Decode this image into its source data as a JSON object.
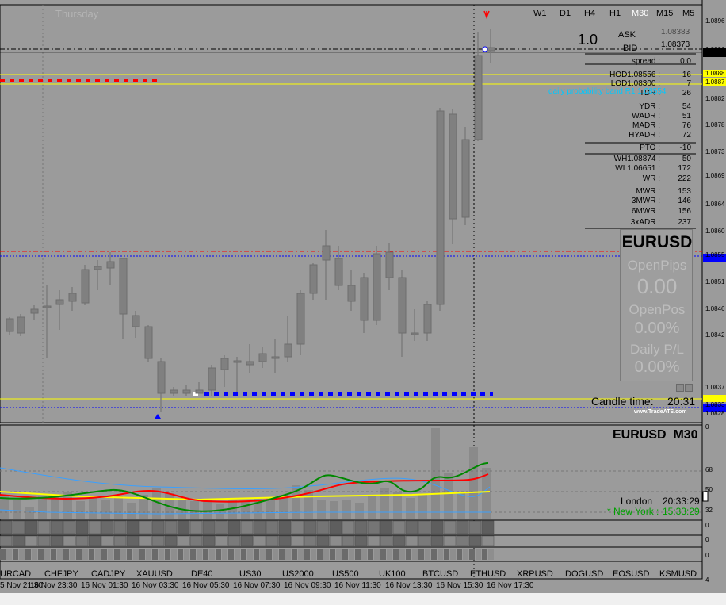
{
  "colors": {
    "bg": "#9b9b9b",
    "bull": "#8c8c8c",
    "bear": "#808080",
    "yellow": "#ffff00",
    "red": "#ff0000",
    "blue": "#0000ff",
    "green": "#008800",
    "cyan": "#00c8ff"
  },
  "header": {
    "day_label": "Thursday",
    "ratio": "1.0",
    "ask_label": "ASK",
    "ask_value": "1.08383",
    "bid_label": "BID",
    "bid_value": "1.08373"
  },
  "timeframes": [
    {
      "label": "W1",
      "active": false
    },
    {
      "label": "D1",
      "active": false
    },
    {
      "label": "H4",
      "active": false
    },
    {
      "label": "H1",
      "active": false
    },
    {
      "label": "M30",
      "active": true
    },
    {
      "label": "M15",
      "active": false
    },
    {
      "label": "M5",
      "active": false
    }
  ],
  "stats": [
    {
      "label": "spread :",
      "value": "0.0"
    },
    {
      "label": "HOD1.08556 :",
      "value": "16"
    },
    {
      "label": "LOD1.08300 :",
      "value": "7"
    },
    {
      "label": "TDR :",
      "value": "26"
    },
    {
      "label": "YDR :",
      "value": "54"
    },
    {
      "label": "WADR :",
      "value": "51"
    },
    {
      "label": "MADR :",
      "value": "76"
    },
    {
      "label": "HYADR :",
      "value": "72"
    },
    {
      "label": "PTO :",
      "value": "-10"
    },
    {
      "label": "WH1.08874 :",
      "value": "50"
    },
    {
      "label": "WL1.06651 :",
      "value": "172"
    },
    {
      "label": "WR :",
      "value": "222"
    },
    {
      "label": "MWR :",
      "value": "153"
    },
    {
      "label": "3MWR :",
      "value": "146"
    },
    {
      "label": "6MWR :",
      "value": "156"
    },
    {
      "label": "3xADR :",
      "value": "237"
    }
  ],
  "probability_band": "daily probability band R1 1.08554",
  "info_panel": {
    "symbol": "EURUSD",
    "open_pips_label": "OpenPips",
    "open_pips_value": "0.00",
    "open_pos_label": "OpenPos",
    "open_pos_value": "0.00%",
    "daily_pl_label": "Daily P/L",
    "daily_pl_value": "0.00%"
  },
  "candle_time": {
    "label": "Candle time:",
    "value": "20:31"
  },
  "watermark": "www.TradeATS.com",
  "price_axis": [
    "1.0896",
    "1.0891",
    "1.0888",
    "1.0887",
    "1.0882",
    "1.0878",
    "1.0873",
    "1.0869",
    "1.0864",
    "1.0860",
    "1.0855",
    "1.0851",
    "1.0846",
    "1.0842",
    "1.0837",
    "1.0833",
    "1.0828"
  ],
  "sub_header": "EURUSD  M30",
  "sub_axis": [
    "0",
    "68",
    "50",
    "32",
    "0",
    "0",
    "0",
    "4"
  ],
  "sessions": {
    "london_label": "London",
    "london_time": "20:33:29",
    "ny_label": "* New York :",
    "ny_time": "15:33:29"
  },
  "symbols": [
    "URCAD",
    "CHFJPY",
    "CADJPY",
    "XAUUSD",
    "DE40",
    "US30",
    "US2000",
    "US500",
    "UK100",
    "BTCUSD",
    "ETHUSD",
    "XRPUSD",
    "DOGUSD",
    "EOSUSD",
    "KSMUSD"
  ],
  "time_axis": [
    "5 Nov 21:30",
    "16 Nov 23:30",
    "16 Nov 01:30",
    "16 Nov 03:30",
    "16 Nov 05:30",
    "16 Nov 07:30",
    "16 Nov 09:30",
    "16 Nov 11:30",
    "16 Nov 13:30",
    "16 Nov 15:30",
    "16 Nov 17:30"
  ]
}
